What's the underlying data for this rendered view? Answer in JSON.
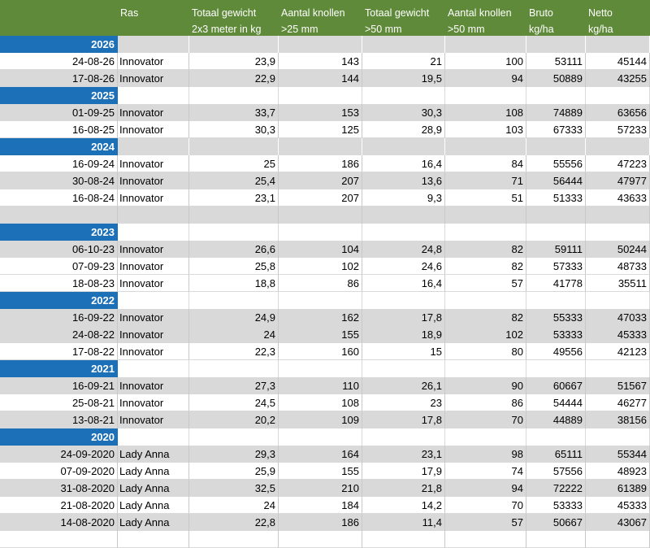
{
  "header": {
    "ras": "Ras",
    "col_totaal_1": "Totaal gewicht",
    "col_totaal_1_sub": "2x3 meter in kg",
    "col_aantal_1": "Aantal knollen",
    "col_aantal_1_sub": ">25 mm",
    "col_totaal_2": "Totaal gewicht",
    "col_totaal_2_sub": ">50 mm",
    "col_aantal_2": "Aantal knollen",
    "col_aantal_2_sub": ">50 mm",
    "col_bruto": "Bruto",
    "col_bruto_sub": "kg/ha",
    "col_netto": "Netto",
    "col_netto_sub": "kg/ha"
  },
  "rows": [
    {
      "type": "year",
      "label": "2026",
      "shade": "grey"
    },
    {
      "type": "data",
      "shade": "white",
      "date": "24-08-26",
      "ras": "Innovator",
      "tg25": "23,9",
      "ak25": "143",
      "tg50": "21",
      "ak50": "100",
      "bruto": "53111",
      "netto": "45144"
    },
    {
      "type": "data",
      "shade": "grey",
      "date": "17-08-26",
      "ras": "Innovator",
      "tg25": "22,9",
      "ak25": "144",
      "tg50": "19,5",
      "ak50": "94",
      "bruto": "50889",
      "netto": "43255"
    },
    {
      "type": "year",
      "label": "2025",
      "shade": "white"
    },
    {
      "type": "data",
      "shade": "grey",
      "date": "01-09-25",
      "ras": "Innovator",
      "tg25": "33,7",
      "ak25": "153",
      "tg50": "30,3",
      "ak50": "108",
      "bruto": "74889",
      "netto": "63656"
    },
    {
      "type": "data",
      "shade": "white",
      "date": "16-08-25",
      "ras": "Innovator",
      "tg25": "30,3",
      "ak25": "125",
      "tg50": "28,9",
      "ak50": "103",
      "bruto": "67333",
      "netto": "57233"
    },
    {
      "type": "year",
      "label": "2024",
      "shade": "grey"
    },
    {
      "type": "data",
      "shade": "white",
      "date": "16-09-24",
      "ras": "Innovator",
      "tg25": "25",
      "ak25": "186",
      "tg50": "16,4",
      "ak50": "84",
      "bruto": "55556",
      "netto": "47223"
    },
    {
      "type": "data",
      "shade": "grey",
      "date": "30-08-24",
      "ras": "Innovator",
      "tg25": "25,4",
      "ak25": "207",
      "tg50": "13,6",
      "ak50": "71",
      "bruto": "56444",
      "netto": "47977"
    },
    {
      "type": "data",
      "shade": "white",
      "date": "16-08-24",
      "ras": "Innovator",
      "tg25": "23,1",
      "ak25": "207",
      "tg50": "9,3",
      "ak50": "51",
      "bruto": "51333",
      "netto": "43633"
    },
    {
      "type": "empty",
      "shade": "grey"
    },
    {
      "type": "year",
      "label": "2023",
      "shade": "white"
    },
    {
      "type": "data",
      "shade": "grey",
      "date": "06-10-23",
      "ras": "Innovator",
      "tg25": "26,6",
      "ak25": "104",
      "tg50": "24,8",
      "ak50": "82",
      "bruto": "59111",
      "netto": "50244"
    },
    {
      "type": "data",
      "shade": "white",
      "date": "07-09-23",
      "ras": "Innovator",
      "tg25": "25,8",
      "ak25": "102",
      "tg50": "24,6",
      "ak50": "82",
      "bruto": "57333",
      "netto": "48733"
    },
    {
      "type": "data",
      "shade": "white",
      "date": "18-08-23",
      "ras": "Innovator",
      "tg25": "18,8",
      "ak25": "86",
      "tg50": "16,4",
      "ak50": "57",
      "bruto": "41778",
      "netto": "35511"
    },
    {
      "type": "year",
      "label": "2022",
      "shade": "white"
    },
    {
      "type": "data",
      "shade": "grey",
      "date": "16-09-22",
      "ras": "Innovator",
      "tg25": "24,9",
      "ak25": "162",
      "tg50": "17,8",
      "ak50": "82",
      "bruto": "55333",
      "netto": "47033"
    },
    {
      "type": "data",
      "shade": "grey",
      "date": "24-08-22",
      "ras": "Innovator",
      "tg25": "24",
      "ak25": "155",
      "tg50": "18,9",
      "ak50": "102",
      "bruto": "53333",
      "netto": "45333"
    },
    {
      "type": "data",
      "shade": "white",
      "date": "17-08-22",
      "ras": "Innovator",
      "tg25": "22,3",
      "ak25": "160",
      "tg50": "15",
      "ak50": "80",
      "bruto": "49556",
      "netto": "42123"
    },
    {
      "type": "year",
      "label": "2021",
      "shade": "white"
    },
    {
      "type": "data",
      "shade": "grey",
      "date": "16-09-21",
      "ras": "Innovator",
      "tg25": "27,3",
      "ak25": "110",
      "tg50": "26,1",
      "ak50": "90",
      "bruto": "60667",
      "netto": "51567"
    },
    {
      "type": "data",
      "shade": "white",
      "date": "25-08-21",
      "ras": "Innovator",
      "tg25": "24,5",
      "ak25": "108",
      "tg50": "23",
      "ak50": "86",
      "bruto": "54444",
      "netto": "46277"
    },
    {
      "type": "data",
      "shade": "grey",
      "date": "13-08-21",
      "ras": "Innovator",
      "tg25": "20,2",
      "ak25": "109",
      "tg50": "17,8",
      "ak50": "70",
      "bruto": "44889",
      "netto": "38156"
    },
    {
      "type": "year",
      "label": "2020",
      "shade": "white"
    },
    {
      "type": "data",
      "shade": "grey",
      "date": "24-09-2020",
      "ras": "Lady Anna",
      "tg25": "29,3",
      "ak25": "164",
      "tg50": "23,1",
      "ak50": "98",
      "bruto": "65111",
      "netto": "55344"
    },
    {
      "type": "data",
      "shade": "white",
      "date": "07-09-2020",
      "ras": "Lady Anna",
      "tg25": "25,9",
      "ak25": "155",
      "tg50": "17,9",
      "ak50": "74",
      "bruto": "57556",
      "netto": "48923"
    },
    {
      "type": "data",
      "shade": "grey",
      "date": "31-08-2020",
      "ras": "Lady Anna",
      "tg25": "32,5",
      "ak25": "210",
      "tg50": "21,8",
      "ak50": "94",
      "bruto": "72222",
      "netto": "61389"
    },
    {
      "type": "data",
      "shade": "white",
      "date": "21-08-2020",
      "ras": "Lady Anna",
      "tg25": "24",
      "ak25": "184",
      "tg50": "14,2",
      "ak50": "70",
      "bruto": "53333",
      "netto": "45333"
    },
    {
      "type": "data",
      "shade": "grey",
      "date": "14-08-2020",
      "ras": "Lady Anna",
      "tg25": "22,8",
      "ak25": "186",
      "tg50": "11,4",
      "ak50": "57",
      "bruto": "50667",
      "netto": "43067"
    },
    {
      "type": "empty",
      "shade": "white"
    }
  ]
}
